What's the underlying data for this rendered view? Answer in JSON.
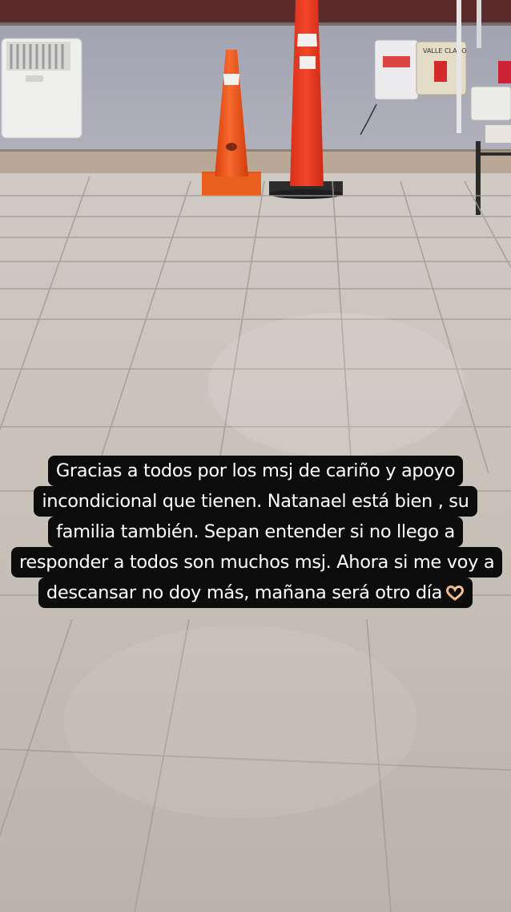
{
  "photo": {
    "description_icon": "photo-background",
    "signs": {
      "valle_claro": "VALLE CLARO"
    }
  },
  "caption": {
    "lines": [
      "Gracias a todos por los msj de cariño y apoyo",
      "incondicional que tienen. Natanael está bien , su",
      "familia también. Sepan entender si no llego a",
      "responder a todos son muchos msj. Ahora si me voy a",
      "descansar no doy más, mañana será otro día"
    ],
    "emoji": "heart-hands-icon"
  },
  "colors": {
    "caption_bg": "#0c0c0c",
    "caption_text": "#ffffff",
    "cone_orange": "#f2561d",
    "wall": "#a9aab7",
    "floor": "#c8c2b9"
  }
}
